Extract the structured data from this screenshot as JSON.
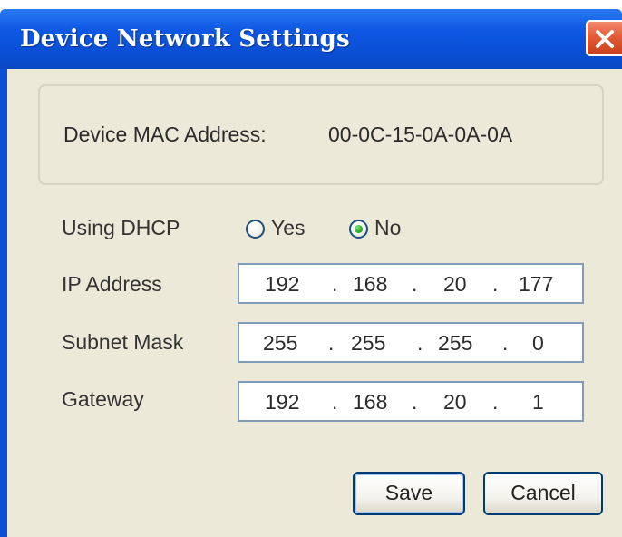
{
  "window": {
    "title": "Device Network Settings"
  },
  "mac": {
    "label": "Device MAC Address:",
    "value": "00-0C-15-0A-0A-0A"
  },
  "dhcp": {
    "label": "Using DHCP",
    "options": [
      "Yes",
      "No"
    ],
    "selected": "No"
  },
  "ip_address": {
    "label": "IP Address",
    "octets": [
      "192",
      "168",
      "20",
      "177"
    ]
  },
  "subnet_mask": {
    "label": "Subnet Mask",
    "octets": [
      "255",
      "255",
      "255",
      "0"
    ]
  },
  "gateway": {
    "label": "Gateway",
    "octets": [
      "192",
      "168",
      "20",
      "1"
    ]
  },
  "separator": ".",
  "buttons": {
    "save": "Save",
    "cancel": "Cancel"
  },
  "colors": {
    "titlebar": "#0a4fd6",
    "client": "#ece9d8",
    "close_button": "#e35b35"
  },
  "icons": {
    "close": "close-icon"
  }
}
